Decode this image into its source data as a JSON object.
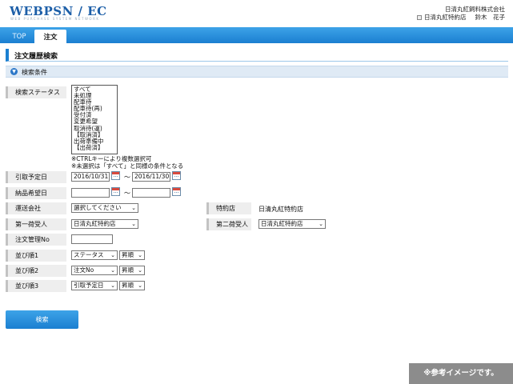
{
  "header": {
    "logo": "WEBPSN / EC",
    "logo_sub": "WEB PURCHASE SYSTEM NETWORK",
    "company": "日清丸紅飼料株式会社",
    "store": "日清丸紅特約店",
    "user_name": "鈴木　花子"
  },
  "tabs": [
    {
      "label": "TOP"
    },
    {
      "label": "注文"
    }
  ],
  "page_title": "注文履歴検索",
  "conditions_label": "検索条件",
  "form": {
    "status_label": "検索ステータス",
    "status_options": [
      "すべて",
      "未処理",
      "配車待",
      "配車待(再)",
      "受付済",
      "変更希望",
      "取消待(運)",
      "【取消済】",
      "出荷準備中",
      "【出荷済】"
    ],
    "note1": "※CTRLキーにより複数選択可",
    "note2": "※未選択は「すべて」と同様の条件となる",
    "pickup_label": "引取予定日",
    "pickup_from": "2016/10/31",
    "pickup_to": "2016/11/30",
    "tilde": "～",
    "delivery_label": "納品希望日",
    "delivery_from": "",
    "delivery_to": "",
    "carrier_label": "運送会社",
    "carrier_value": "選択してください",
    "agent_label": "特約店",
    "agent_value": "日清丸紅特約店",
    "consignee1_label": "第一荷受人",
    "consignee1_value": "日清丸紅特約店",
    "consignee2_label": "第二荷受人",
    "consignee2_value": "日清丸紅特約店",
    "order_mgmt_label": "注文管理No",
    "order_mgmt_value": "",
    "sort1_label": "並び順1",
    "sort1_field": "ステータス",
    "sort1_dir": "昇順",
    "sort2_label": "並び順2",
    "sort2_field": "注文No",
    "sort2_dir": "昇順",
    "sort3_label": "並び順3",
    "sort3_field": "引取予定日",
    "sort3_dir": "昇順"
  },
  "search_button": "検索",
  "sample_badge": "※参考イメージです。",
  "colors": {
    "accent": "#1b7fd1",
    "label_bg": "#eeeeee"
  }
}
